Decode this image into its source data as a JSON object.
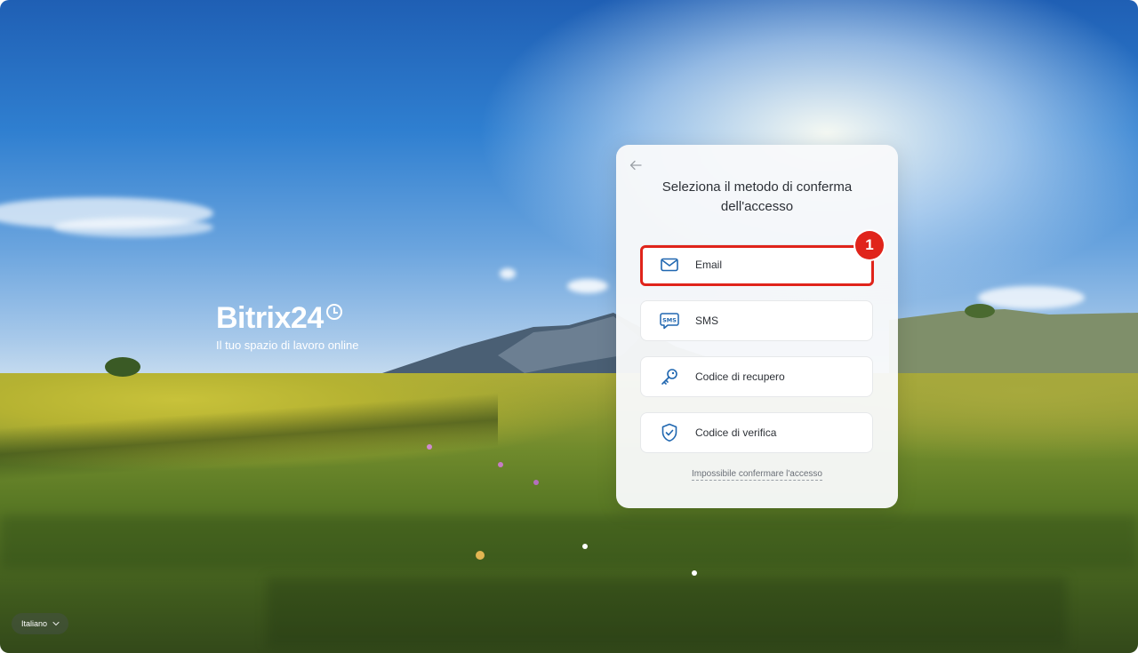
{
  "brand": {
    "name": "Bitrix24",
    "tagline": "Il tuo spazio di lavoro online"
  },
  "card": {
    "title": "Seleziona il metodo di conferma dell'accesso",
    "back_icon": "arrow-left-icon",
    "options": [
      {
        "label": "Email",
        "icon": "envelope-icon"
      },
      {
        "label": "SMS",
        "icon": "sms-icon"
      },
      {
        "label": "Codice di recupero",
        "icon": "key-icon"
      },
      {
        "label": "Codice di verifica",
        "icon": "shield-check-icon"
      }
    ],
    "help_link": "Impossibile confermare l'accesso"
  },
  "annotation": {
    "badge_number": "1",
    "color": "#e0241b"
  },
  "language": {
    "selected": "Italiano"
  },
  "colors": {
    "accent_icon": "#2067b0",
    "text": "#2d3137"
  }
}
